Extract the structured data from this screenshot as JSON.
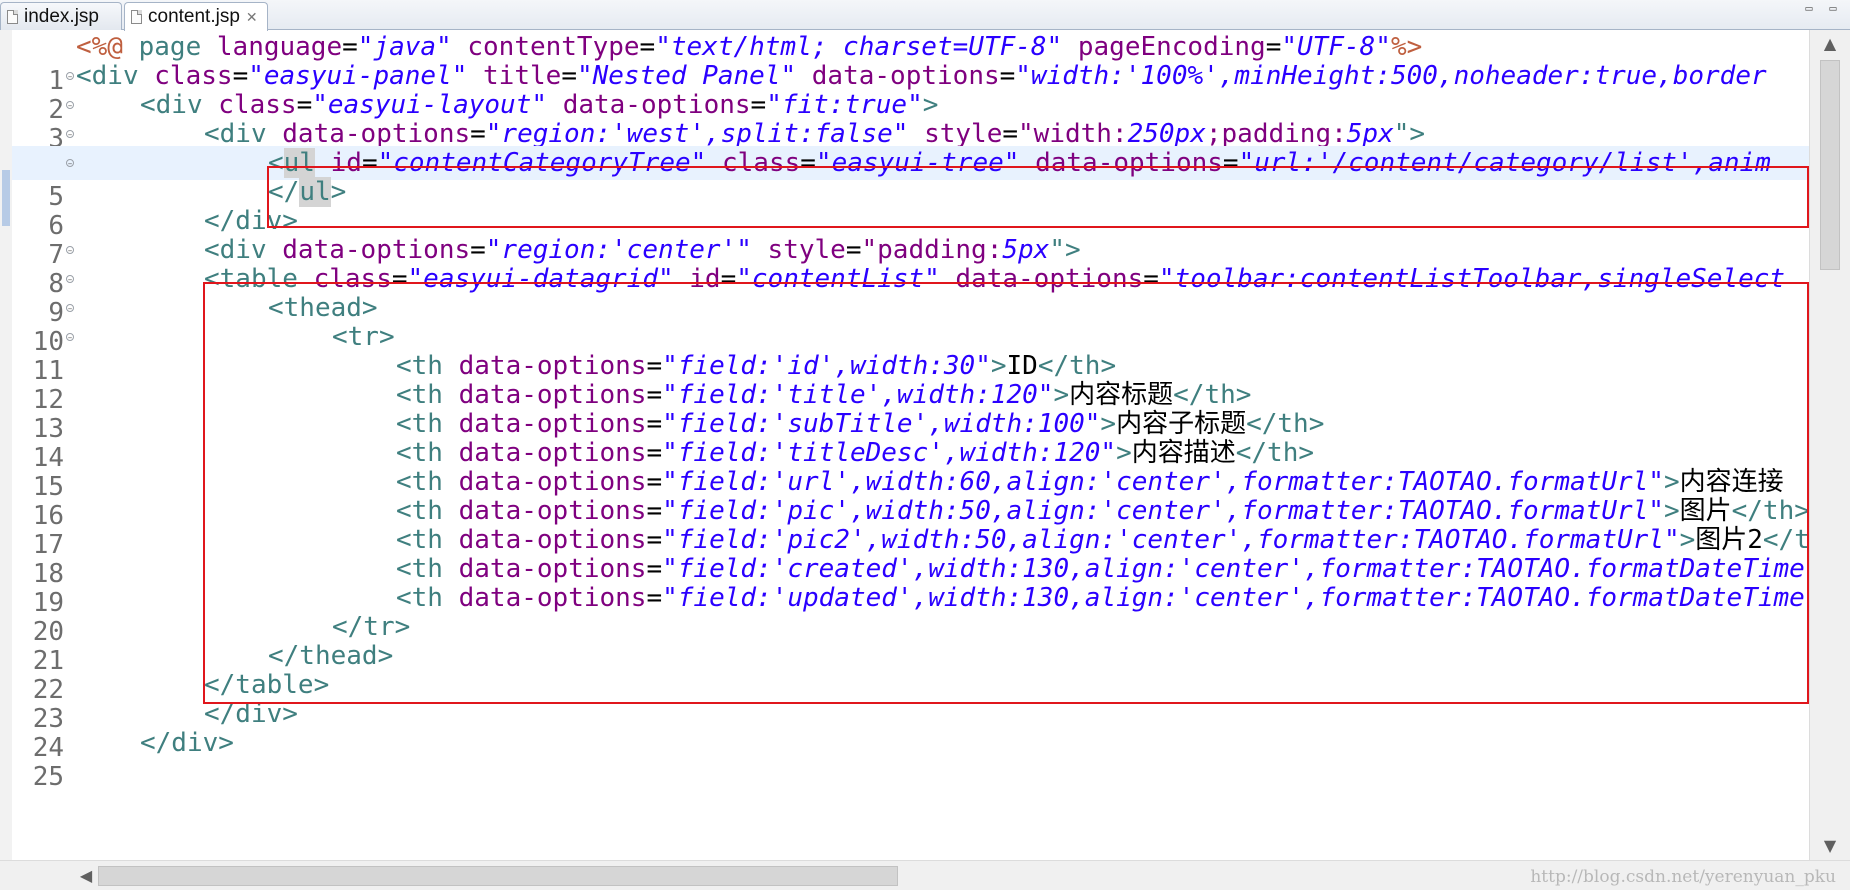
{
  "tabs": [
    {
      "label": "index.jsp",
      "icon": "jsp-file-icon"
    },
    {
      "label": "content.jsp",
      "icon": "jsp-file-icon",
      "close": "✕"
    }
  ],
  "window_controls": {
    "minimize": "▭",
    "maximize": "▭"
  },
  "editor": {
    "lines": [
      {
        "n": "1"
      },
      {
        "n": "2"
      },
      {
        "n": "3"
      },
      {
        "n": "4"
      },
      {
        "n": "5"
      },
      {
        "n": "6"
      },
      {
        "n": "7"
      },
      {
        "n": "8"
      },
      {
        "n": "9"
      },
      {
        "n": "10"
      },
      {
        "n": "11"
      },
      {
        "n": "12"
      },
      {
        "n": "13"
      },
      {
        "n": "14"
      },
      {
        "n": "15"
      },
      {
        "n": "16"
      },
      {
        "n": "17"
      },
      {
        "n": "18"
      },
      {
        "n": "19"
      },
      {
        "n": "20"
      },
      {
        "n": "21"
      },
      {
        "n": "22"
      },
      {
        "n": "23"
      },
      {
        "n": "24"
      },
      {
        "n": "25"
      }
    ],
    "tokens": {
      "l1": [
        "<%@",
        " page ",
        "language",
        "=",
        "\"java\"",
        " ",
        "contentType",
        "=",
        "\"text/html; charset=UTF-8\"",
        " ",
        "pageEncoding",
        "=",
        "\"UTF-8\"",
        "%>"
      ],
      "l2": [
        "<div",
        " ",
        "class",
        "=",
        "\"easyui-panel\"",
        " ",
        "title",
        "=",
        "\"Nested Panel\"",
        " ",
        "data-options",
        "=",
        "\"width:'100%',minHeight:500,noheader:true,border"
      ],
      "l3": [
        "<div",
        " ",
        "class",
        "=",
        "\"easyui-layout\"",
        " ",
        "data-options",
        "=",
        "\"fit:true\"",
        ">"
      ],
      "l4": [
        "<div",
        " ",
        "data-options",
        "=",
        "\"region:'west',split:false\"",
        " ",
        "style",
        "=",
        "\"width:",
        "250px",
        ";padding:",
        "5px",
        "\">"
      ],
      "l5": [
        "<",
        "ul",
        " ",
        "id",
        "=",
        "\"contentCategoryTree\"",
        " ",
        "class",
        "=",
        "\"easyui-tree\"",
        " ",
        "data-options",
        "=",
        "\"url:'/content/category/list',anim"
      ],
      "l6": [
        "</",
        "ul",
        ">"
      ],
      "l7": [
        "</div>"
      ],
      "l8": [
        "<div",
        " ",
        "data-options",
        "=",
        "\"region:'center'\"",
        " ",
        "style",
        "=",
        "\"padding:",
        "5px",
        "\">"
      ],
      "l9": [
        "<table",
        " ",
        "class",
        "=",
        "\"easyui-datagrid\"",
        " ",
        "id",
        "=",
        "\"contentList\"",
        " ",
        "data-options",
        "=",
        "\"toolbar:contentListToolbar,singleSelect"
      ],
      "l10": [
        "<thead>"
      ],
      "l11": [
        "<tr>"
      ],
      "l12": [
        "<th",
        " ",
        "data-options",
        "=",
        "\"field:'id',width:30\"",
        ">",
        "ID",
        "</th>"
      ],
      "l13": [
        "<th",
        " ",
        "data-options",
        "=",
        "\"field:'title',width:120\"",
        ">",
        "内容标题",
        "</th>"
      ],
      "l14": [
        "<th",
        " ",
        "data-options",
        "=",
        "\"field:'subTitle',width:100\"",
        ">",
        "内容子标题",
        "</th>"
      ],
      "l15": [
        "<th",
        " ",
        "data-options",
        "=",
        "\"field:'titleDesc',width:120\"",
        ">",
        "内容描述",
        "</th>"
      ],
      "l16": [
        "<th",
        " ",
        "data-options",
        "=",
        "\"field:'url',width:60,align:'center',formatter:TAOTAO.formatUrl\"",
        ">",
        "内容连接"
      ],
      "l17": [
        "<th",
        " ",
        "data-options",
        "=",
        "\"field:'pic',width:50,align:'center',formatter:TAOTAO.formatUrl\"",
        ">",
        "图片",
        "</th>"
      ],
      "l18": [
        "<th",
        " ",
        "data-options",
        "=",
        "\"field:'pic2',width:50,align:'center',formatter:TAOTAO.formatUrl\"",
        ">",
        "图片2",
        "</th>"
      ],
      "l19": [
        "<th",
        " ",
        "data-options",
        "=",
        "\"field:'created',width:130,align:'center',formatter:TAOTAO.formatDateTime"
      ],
      "l20": [
        "<th",
        " ",
        "data-options",
        "=",
        "\"field:'updated',width:130,align:'center',formatter:TAOTAO.formatDateTime"
      ],
      "l21": [
        "</tr>"
      ],
      "l22": [
        "</thead>"
      ],
      "l23": [
        "</table>"
      ],
      "l24": [
        "</div>"
      ],
      "l25": [
        "</div>"
      ]
    }
  },
  "scrollbar": {
    "up": "▲",
    "down": "▼",
    "left": "◀",
    "right": "▶"
  },
  "watermark": "http://blog.csdn.net/yerenyuan_pku"
}
